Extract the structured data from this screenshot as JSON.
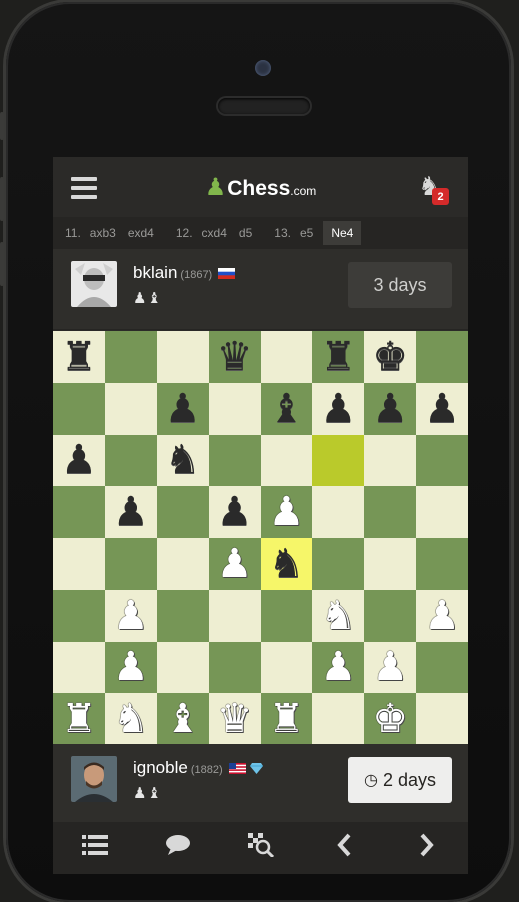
{
  "colors": {
    "light_square": "#eeeed2",
    "dark_square": "#769656",
    "highlight": "#baca2b",
    "brand_green": "#81b64c",
    "badge_red": "#d42a2a"
  },
  "header": {
    "logo_icon": "pawn-icon",
    "brand": "Chess",
    "domain": ".com",
    "challenges_badge": "2"
  },
  "moves": [
    {
      "num": "11.",
      "white": "axb3",
      "black": "exd4"
    },
    {
      "num": "12.",
      "white": "cxd4",
      "black": "d5"
    },
    {
      "num": "13.",
      "white": "e5",
      "black": "Ne4",
      "current": "black"
    }
  ],
  "top_player": {
    "name": "bklain",
    "rating": "(1867)",
    "flag": "russia-flag",
    "captured": "♟♝",
    "clock": "3 days"
  },
  "bottom_player": {
    "name": "ignoble",
    "rating": "(1882)",
    "flag": "us-flag",
    "badge": "diamond-icon",
    "captured": "♟♝",
    "clock_icon": "◷",
    "clock": "2 days"
  },
  "board": [
    [
      "bR",
      "",
      "",
      "bQ",
      "",
      "bR",
      "bK",
      ""
    ],
    [
      "",
      "",
      "bP",
      "",
      "bB",
      "bP",
      "bP",
      "bP"
    ],
    [
      "bP",
      "",
      "bN",
      "",
      "",
      "",
      "",
      ""
    ],
    [
      "",
      "bP",
      "",
      "bP",
      "wP",
      "",
      "",
      ""
    ],
    [
      "",
      "",
      "",
      "wP",
      "bN",
      "",
      "",
      ""
    ],
    [
      "",
      "wP",
      "",
      "",
      "",
      "wN",
      "",
      "wP"
    ],
    [
      "",
      "wP",
      "",
      "",
      "",
      "wP",
      "wP",
      ""
    ],
    [
      "wR",
      "wN",
      "wB",
      "wQ",
      "wR",
      "",
      "wK",
      ""
    ]
  ],
  "highlights": [
    "f6",
    "e4"
  ],
  "toolbar": [
    "moves-list-icon",
    "chat-icon",
    "analysis-icon",
    "back-arrow-icon",
    "forward-arrow-icon"
  ]
}
